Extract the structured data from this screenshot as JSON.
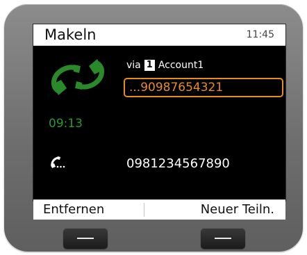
{
  "screen": {
    "title": "Makeln",
    "time": "11:45"
  },
  "active_call": {
    "icon": "active-call-icon",
    "icon_color": "#2a8a2a",
    "via_label": "via",
    "account_number": "1",
    "account_name": "Account1",
    "number": "...90987654321",
    "number_color": "#e98c1d",
    "duration": "09:13",
    "duration_color": "#2a9a2a"
  },
  "held_call": {
    "icon": "held-call-icon",
    "number": "0981234567890"
  },
  "softkeys": {
    "left_label": "Entfernen",
    "right_label": "Neuer Teiln."
  }
}
